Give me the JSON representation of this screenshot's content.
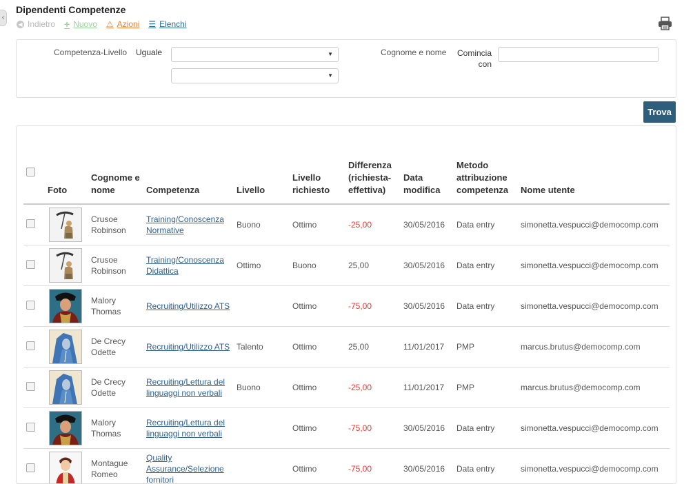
{
  "page": {
    "title": "Dipendenti Competenze"
  },
  "toolbar": {
    "back": "Indietro",
    "new": "Nuovo",
    "actions": "Azioni",
    "lists": "Elenchi"
  },
  "filters": {
    "competence_label": "Competenza-Livello",
    "competence_operator": "Uguale",
    "select1_value": "",
    "select2_value": "",
    "name_label": "Cognome e nome",
    "name_operator": "Comincia con",
    "name_value": ""
  },
  "find_button": "Trova",
  "table": {
    "headers": {
      "photo": "Foto",
      "name": "Cognome e nome",
      "competence": "Competenza",
      "level": "Livello",
      "required": "Livello richiesto",
      "difference": "Differenza (richiesta-effettiva)",
      "date": "Data modifica",
      "method": "Metodo attribuzione competenza",
      "user": "Nome utente"
    },
    "rows": [
      {
        "photo": "crusoe",
        "name": "Crusoe Robinson",
        "competence": "Training/Conoscenza Normative",
        "level": "Buono",
        "required": "Ottimo",
        "difference": "-25,00",
        "negative": true,
        "date": "30/05/2016",
        "method": "Data entry",
        "user": "simonetta.vespucci@democomp.com"
      },
      {
        "photo": "crusoe",
        "name": "Crusoe Robinson",
        "competence": "Training/Conoscenza Didattica",
        "level": "Ottimo",
        "required": "Buono",
        "difference": "25,00",
        "negative": false,
        "date": "30/05/2016",
        "method": "Data entry",
        "user": "simonetta.vespucci@democomp.com"
      },
      {
        "photo": "malory",
        "name": "Malory Thomas",
        "competence": "Recruiting/Utilizzo ATS",
        "level": "",
        "required": "Ottimo",
        "difference": "-75,00",
        "negative": true,
        "date": "30/05/2016",
        "method": "Data entry",
        "user": "simonetta.vespucci@democomp.com"
      },
      {
        "photo": "odette",
        "name": "De Crecy Odette",
        "competence": "Recruiting/Utilizzo ATS",
        "level": "Talento",
        "required": "Ottimo",
        "difference": "25,00",
        "negative": false,
        "date": "11/01/2017",
        "method": "PMP",
        "user": "marcus.brutus@democomp.com"
      },
      {
        "photo": "odette",
        "name": "De Crecy Odette",
        "competence": "Recruiting/Lettura del linguaggi non verbali",
        "level": "Buono",
        "required": "Ottimo",
        "difference": "-25,00",
        "negative": true,
        "date": "11/01/2017",
        "method": "PMP",
        "user": "marcus.brutus@democomp.com"
      },
      {
        "photo": "malory",
        "name": "Malory Thomas",
        "competence": "Recruiting/Lettura del linguaggi non verbali",
        "level": "",
        "required": "Ottimo",
        "difference": "-75,00",
        "negative": true,
        "date": "30/05/2016",
        "method": "Data entry",
        "user": "simonetta.vespucci@democomp.com"
      },
      {
        "photo": "romeo",
        "name": "Montague Romeo",
        "competence": "Quality Assurance/Selezione fornitori",
        "level": "",
        "required": "Ottimo",
        "difference": "-75,00",
        "negative": true,
        "date": "30/05/2016",
        "method": "Data entry",
        "user": "simonetta.vespucci@democomp.com"
      }
    ]
  },
  "colors": {
    "accent": "#2d5f7c",
    "link": "#2f5f8f",
    "negative": "#e53935",
    "new": "#9bd49b",
    "actions": "#e8823d"
  }
}
